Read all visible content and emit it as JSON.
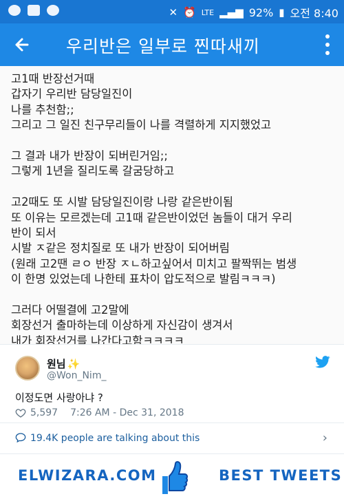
{
  "statusbar": {
    "battery": "92%",
    "network": "LTE",
    "time": "오전 8:40"
  },
  "appbar": {
    "title": "우리반은 일부로 찐따새끼"
  },
  "post": {
    "lines": [
      "고1때 반장선거때",
      "갑자기 우리반 담당일진이",
      "나를 추천함;;",
      "그리고 그 일진 친구무리들이 나를 격렬하게 지지했었고",
      "",
      "그 결과 내가 반장이 되버린거임;;",
      "그렇게 1년을 질리도록 갈굼당하고",
      "",
      "고2때도 또 시발 담당일진이랑 나랑 같은반이됨",
      "또 이유는 모르겠는데 고1때 같은반이었던 놈들이 대거 우리",
      "반이 되서",
      "시발 ㅈ같은 정치질로 또 내가 반장이 되어버림",
      "(원래 고2땐 ㄹㅇ 반장 ㅈㄴ하고싶어서 미치고 팔짝뛰는 범생",
      "이 한명 있었는데 나한테 표차이 압도적으로 발림ㅋㅋㅋ)",
      "",
      "그러다 어떨결에 고2말에",
      "회장선거 출마하는데 이상하게 자신감이 생겨서",
      "내가 회장선거를 나간다고함ㅋㅋㅋㅋ"
    ]
  },
  "tweet": {
    "name": "원님",
    "sparkle": "✨",
    "handle": "@Won_Nim_",
    "text": "이정도면 사랑아냐 ?",
    "likes": "5,597",
    "timestamp": "7:26 AM - Dec 31, 2018",
    "talking": "19.4K people are talking about this"
  },
  "banner": {
    "left": "ELWIZARA.COM",
    "right": "BEST TWEETS"
  },
  "colors": {
    "statusbar": "#1976d2",
    "appbar": "#1e88e5",
    "banner_text": "#1565c0",
    "twitter_blue": "#1da1f2"
  }
}
